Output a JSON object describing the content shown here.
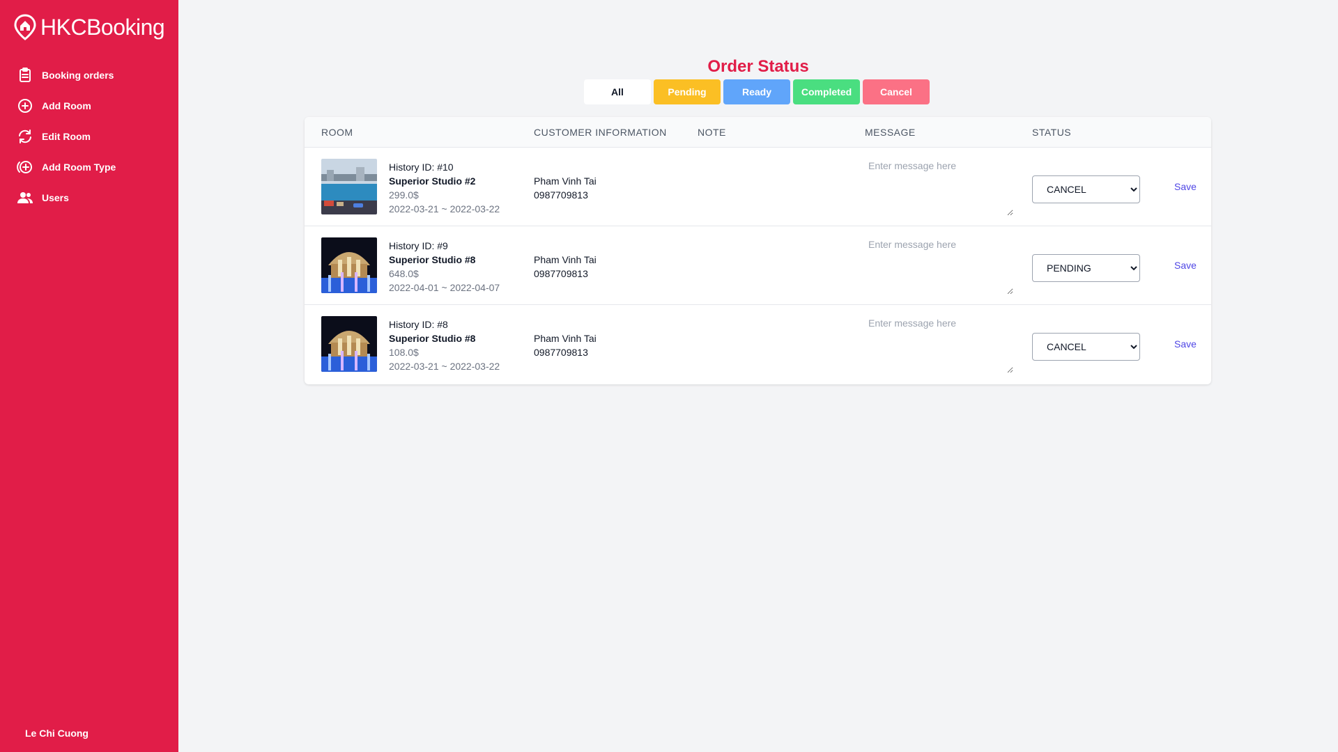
{
  "brand": {
    "name": "HKCBooking"
  },
  "sidebar": {
    "items": [
      {
        "label": "Booking orders",
        "icon": "clipboard-list-icon"
      },
      {
        "label": "Add Room",
        "icon": "plus-circle-icon"
      },
      {
        "label": "Edit Room",
        "icon": "refresh-icon"
      },
      {
        "label": "Add Room Type",
        "icon": "plus-circle-icon"
      },
      {
        "label": "Users",
        "icon": "users-icon"
      }
    ],
    "user_name": "Le Chi Cuong"
  },
  "main": {
    "title": "Order Status",
    "filters": [
      "All",
      "Pending",
      "Ready",
      "Completed",
      "Cancel"
    ],
    "table": {
      "headers": {
        "room": "ROOM",
        "customer": "CUSTOMER INFORMATION",
        "note": "NOTE",
        "message": "MESSAGE",
        "status": "STATUS"
      },
      "rows": [
        {
          "history_id": "History ID: #10",
          "room_name": "Superior Studio #2",
          "price": "299.0$",
          "dates": "2022-03-21 ~ 2022-03-22",
          "customer_name": "Pham Vinh Tai",
          "phone": "0987709813",
          "message_placeholder": "Enter message here",
          "status": "CANCEL",
          "save_label": "Save"
        },
        {
          "history_id": "History ID: #9",
          "room_name": "Superior Studio #8",
          "price": "648.0$",
          "dates": "2022-04-01 ~ 2022-04-07",
          "customer_name": "Pham Vinh Tai",
          "phone": "0987709813",
          "message_placeholder": "Enter message here",
          "status": "PENDING",
          "save_label": "Save"
        },
        {
          "history_id": "History ID: #8",
          "room_name": "Superior Studio #8",
          "price": "108.0$",
          "dates": "2022-03-21 ~ 2022-03-22",
          "customer_name": "Pham Vinh Tai",
          "phone": "0987709813",
          "message_placeholder": "Enter message here",
          "status": "CANCEL",
          "save_label": "Save"
        }
      ]
    }
  },
  "colors": {
    "sidebar": "#e11d48",
    "pending": "#fbbf24",
    "ready": "#60a5fa",
    "completed": "#4ade80",
    "cancel": "#fb7185",
    "link": "#4f46e5"
  }
}
